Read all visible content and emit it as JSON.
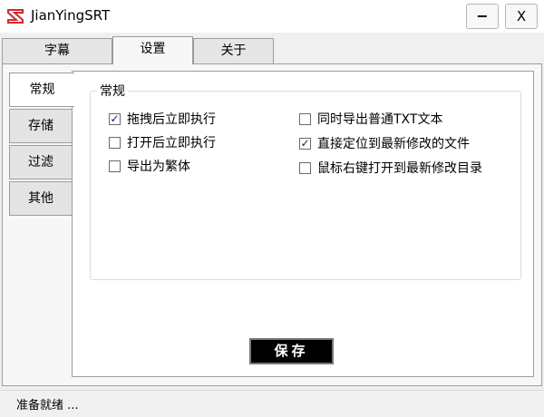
{
  "window": {
    "title": "JianYingSRT",
    "minimize_label": "−",
    "close_label": "X"
  },
  "top_tabs": [
    {
      "label": "字幕",
      "active": false
    },
    {
      "label": "设置",
      "active": true
    },
    {
      "label": "关于",
      "active": false
    }
  ],
  "side_tabs": [
    {
      "label": "常规",
      "active": true
    },
    {
      "label": "存储",
      "active": false
    },
    {
      "label": "过滤",
      "active": false
    },
    {
      "label": "其他",
      "active": false
    }
  ],
  "general": {
    "group_title": "常规",
    "options": [
      {
        "label": "拖拽后立即执行",
        "checked": true
      },
      {
        "label": "打开后立即执行",
        "checked": false
      },
      {
        "label": "导出为繁体",
        "checked": false
      },
      {
        "label": "同时导出普通TXT文本",
        "checked": false
      },
      {
        "label": "直接定位到最新修改的文件",
        "checked": true
      },
      {
        "label": "鼠标右键打开到最新修改目录",
        "checked": false
      }
    ]
  },
  "save_label": "保存",
  "status": "准备就绪 ...",
  "colors": {
    "app_icon": "#d3282f",
    "save_button_bg": "#000000"
  }
}
